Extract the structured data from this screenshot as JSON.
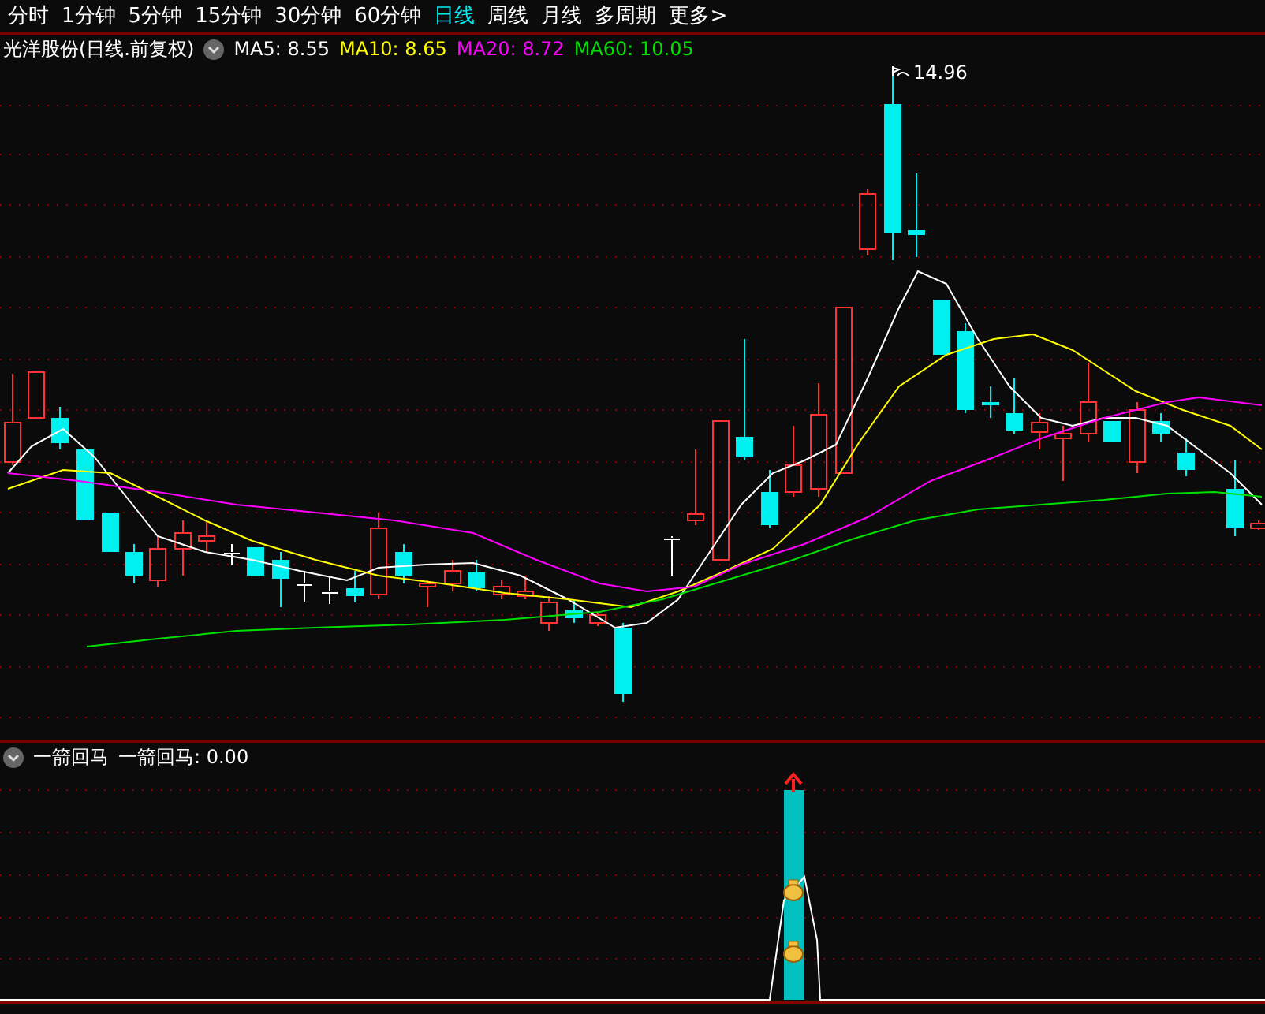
{
  "tabs": [
    {
      "label": "分时",
      "selected": false
    },
    {
      "label": "1分钟",
      "selected": false
    },
    {
      "label": "5分钟",
      "selected": false
    },
    {
      "label": "15分钟",
      "selected": false
    },
    {
      "label": "30分钟",
      "selected": false
    },
    {
      "label": "60分钟",
      "selected": false
    },
    {
      "label": "日线",
      "selected": true
    },
    {
      "label": "周线",
      "selected": false
    },
    {
      "label": "月线",
      "selected": false
    },
    {
      "label": "多周期",
      "selected": false
    },
    {
      "label": "更多>",
      "selected": false
    }
  ],
  "price_panel": {
    "title": "光洋股份(日线.前复权)",
    "indicators": [
      {
        "label": "MA5: 8.55",
        "color": "#ffffff"
      },
      {
        "label": "MA10: 8.65",
        "color": "#ffff00"
      },
      {
        "label": "MA20: 8.72",
        "color": "#ff00ff"
      },
      {
        "label": "MA60: 10.05",
        "color": "#00e000"
      }
    ],
    "high_label": "14.96"
  },
  "indicator_panel": {
    "title": "一箭回马",
    "value": "一箭回马: 0.00"
  }
}
